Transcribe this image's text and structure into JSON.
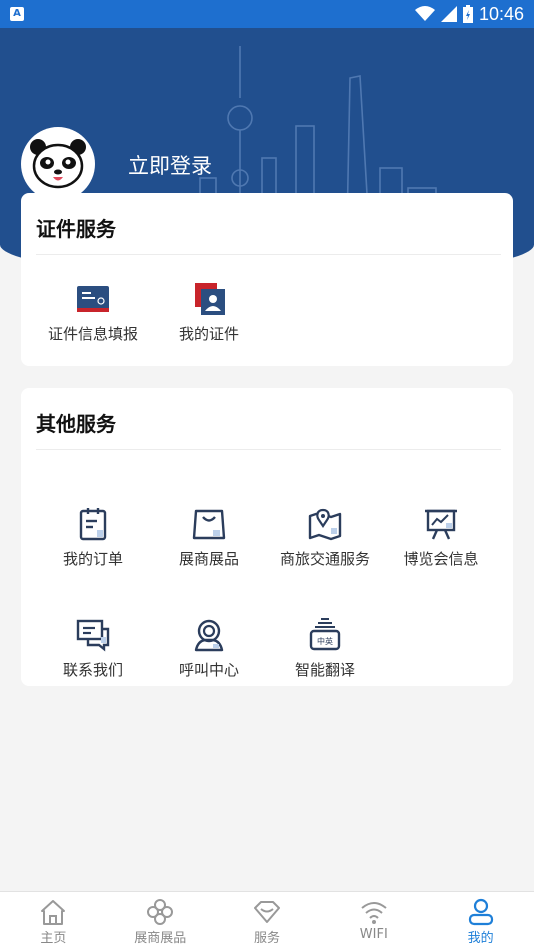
{
  "status_bar": {
    "time": "10:46",
    "app_badge": "A"
  },
  "header": {
    "login_label": "立即登录",
    "avatar_icon": "panda-avatar-icon"
  },
  "cert_card": {
    "title": "证件服务",
    "items": [
      {
        "label": "证件信息填报",
        "icon": "id-card-icon"
      },
      {
        "label": "我的证件",
        "icon": "my-certificate-icon"
      }
    ]
  },
  "other_card": {
    "title": "其他服务",
    "items": [
      {
        "label": "我的订单",
        "icon": "order-clipboard-icon"
      },
      {
        "label": "展商展品",
        "icon": "exhibitor-bag-icon"
      },
      {
        "label": "商旅交通服务",
        "icon": "map-location-icon"
      },
      {
        "label": "博览会信息",
        "icon": "presentation-board-icon"
      },
      {
        "label": "联系我们",
        "icon": "chat-bubbles-icon"
      },
      {
        "label": "呼叫中心",
        "icon": "headset-agent-icon"
      },
      {
        "label": "智能翻译",
        "icon": "translator-device-icon"
      }
    ],
    "translator_glyph": "中英"
  },
  "bottom_nav": {
    "items": [
      {
        "label": "主页",
        "icon": "home-icon",
        "active": false
      },
      {
        "label": "展商展品",
        "icon": "clover-icon",
        "active": false
      },
      {
        "label": "服务",
        "icon": "diamond-icon",
        "active": false
      },
      {
        "label": "WIFI",
        "icon": "wifi-icon",
        "active": false
      },
      {
        "label": "我的",
        "icon": "user-icon",
        "active": true
      }
    ]
  },
  "colors": {
    "status_bar": "#1e6fcf",
    "hero": "#214f8e",
    "accent": "#1e7fd8",
    "icon_dark": "#2b3d5c",
    "icon_red": "#c8242b"
  }
}
